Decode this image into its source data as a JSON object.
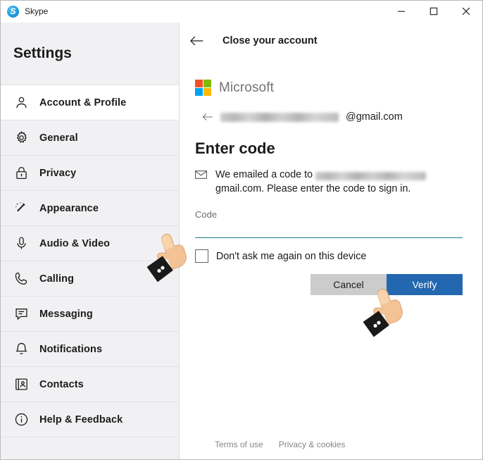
{
  "window": {
    "app_title": "Skype",
    "app_icon": "skype-icon",
    "controls": {
      "minimize": "minimize-icon",
      "maximize": "maximize-icon",
      "close": "close-icon"
    }
  },
  "sidebar": {
    "heading": "Settings",
    "items": [
      {
        "label": "Account & Profile",
        "icon": "person-icon",
        "selected": true
      },
      {
        "label": "General",
        "icon": "gear-icon",
        "selected": false
      },
      {
        "label": "Privacy",
        "icon": "lock-icon",
        "selected": false
      },
      {
        "label": "Appearance",
        "icon": "magic-wand-icon",
        "selected": false
      },
      {
        "label": "Audio & Video",
        "icon": "microphone-icon",
        "selected": false
      },
      {
        "label": "Calling",
        "icon": "phone-icon",
        "selected": false
      },
      {
        "label": "Messaging",
        "icon": "chat-bubble-icon",
        "selected": false
      },
      {
        "label": "Notifications",
        "icon": "bell-icon",
        "selected": false
      },
      {
        "label": "Contacts",
        "icon": "contact-card-icon",
        "selected": false
      },
      {
        "label": "Help & Feedback",
        "icon": "info-circle-icon",
        "selected": false
      }
    ]
  },
  "main": {
    "back_icon": "back-arrow-icon",
    "page_title": "Close your account",
    "brand": {
      "name": "Microsoft",
      "logo_colors": {
        "top_left": "#f25022",
        "top_right": "#7fba00",
        "bottom_left": "#00a4ef",
        "bottom_right": "#ffb900"
      }
    },
    "account": {
      "back_icon": "small-back-arrow-icon",
      "email_redacted": true,
      "email_domain": "@gmail.com"
    },
    "heading": "Enter code",
    "message": {
      "icon": "envelope-icon",
      "line_1": "We emailed a code to",
      "line_2_suffix": "gmail.com. Please enter the",
      "line_3": "code to sign in."
    },
    "code_field": {
      "label": "Code",
      "value": "",
      "placeholder": "",
      "underline_color": "#1a7f8e"
    },
    "checkbox": {
      "label": "Don't ask me again on this device",
      "checked": false
    },
    "buttons": {
      "cancel": "Cancel",
      "verify": "Verify",
      "verify_color": "#2267b0",
      "cancel_color": "#cccccc"
    },
    "footer": {
      "terms": "Terms of use",
      "privacy": "Privacy & cookies"
    }
  },
  "cursors": [
    {
      "name": "hand-pointer-code-field"
    },
    {
      "name": "hand-pointer-verify-button"
    }
  ]
}
